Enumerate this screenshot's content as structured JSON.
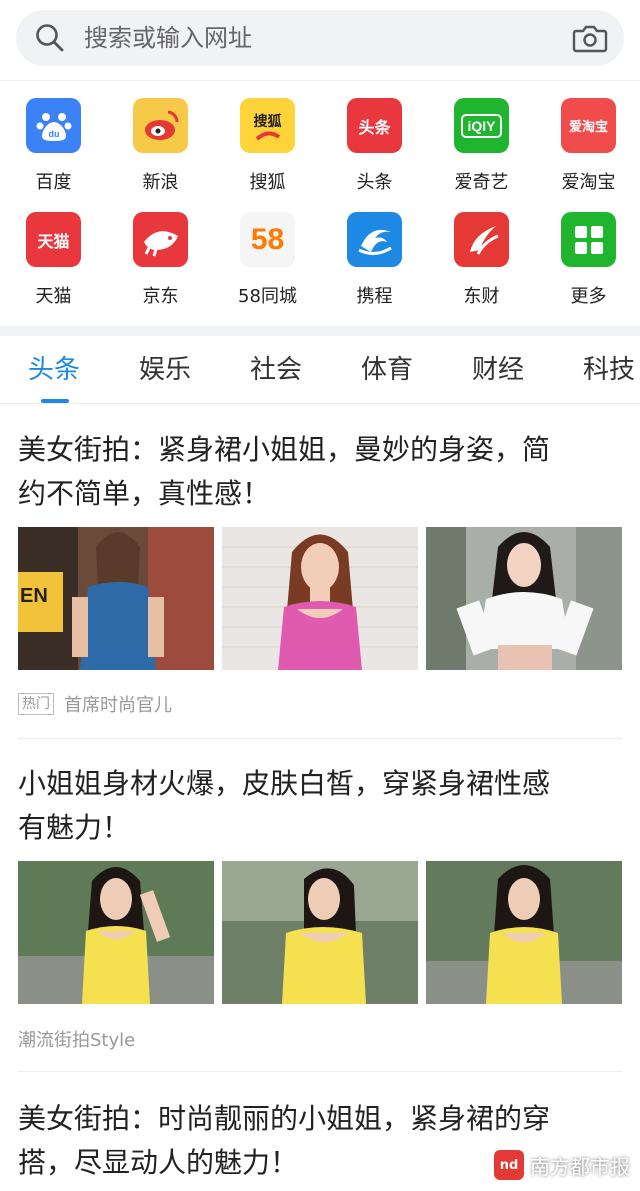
{
  "search": {
    "placeholder": "搜索或输入网址"
  },
  "shortcuts": [
    {
      "label": "百度",
      "icon": "baidu-icon",
      "color": "#3b82f6"
    },
    {
      "label": "新浪",
      "icon": "sina-weibo-icon",
      "color": "#f7c948"
    },
    {
      "label": "搜狐",
      "icon": "sohu-icon",
      "color": "#ffd43b",
      "icon_text": "搜狐"
    },
    {
      "label": "头条",
      "icon": "toutiao-icon",
      "color": "#e8383d",
      "icon_text": "头条"
    },
    {
      "label": "爱奇艺",
      "icon": "iqiyi-icon",
      "color": "#1fb52f",
      "icon_text": "iQIY"
    },
    {
      "label": "爱淘宝",
      "icon": "aitaobao-icon",
      "color": "#f04c4c",
      "icon_text": "爱淘宝"
    },
    {
      "label": "天猫",
      "icon": "tmall-icon",
      "color": "#e8383d",
      "icon_text": "天猫"
    },
    {
      "label": "京东",
      "icon": "jd-icon",
      "color": "#e8383d"
    },
    {
      "label": "58同城",
      "icon": "58-icon",
      "color": "#f5f5f5",
      "icon_text": "58"
    },
    {
      "label": "携程",
      "icon": "ctrip-icon",
      "color": "#1e88e5"
    },
    {
      "label": "东财",
      "icon": "dongcai-icon",
      "color": "#e53935"
    },
    {
      "label": "更多",
      "icon": "more-grid-icon",
      "color": "#1fb52f"
    }
  ],
  "tabs": [
    {
      "label": "头条",
      "active": true
    },
    {
      "label": "娱乐"
    },
    {
      "label": "社会"
    },
    {
      "label": "体育"
    },
    {
      "label": "财经"
    },
    {
      "label": "科技"
    }
  ],
  "articles": [
    {
      "title_line1": "美女街拍：紧身裙小姐姐，曼妙的身姿，简",
      "title_line2": "约不简单，真性感！",
      "badge": "热门",
      "source": "首席时尚官儿"
    },
    {
      "title_line1": "小姐姐身材火爆，皮肤白皙，穿紧身裙性感",
      "title_line2": "有魅力！",
      "source": "潮流街拍Style"
    },
    {
      "title_line1": "美女街拍：时尚靓丽的小姐姐，紧身裙的穿",
      "title_line2": "搭，尽显动人的魅力！"
    }
  ],
  "watermark": {
    "logo": "nd",
    "text": "南方都市报"
  }
}
